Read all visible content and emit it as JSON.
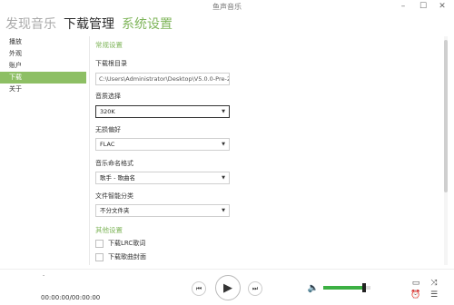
{
  "app": {
    "title": "鱼声音乐"
  },
  "window_controls": {
    "minimize": "–",
    "maximize": "☐",
    "close": "✕"
  },
  "tabs": [
    {
      "label": "发现音乐"
    },
    {
      "label": "下载管理"
    },
    {
      "label": "系统设置"
    }
  ],
  "sidebar": {
    "items": [
      {
        "label": "播放"
      },
      {
        "label": "外观"
      },
      {
        "label": "账户"
      },
      {
        "label": "下载"
      },
      {
        "label": "关于"
      }
    ]
  },
  "settings": {
    "general_title": "常规设置",
    "download_dir_label": "下载根目录",
    "download_dir_value": "C:\\Users\\Administrator\\Desktop\\V5.0.0-Pre-2",
    "quality_label": "音质选择",
    "quality_value": "320K",
    "lossless_label": "无损偏好",
    "lossless_value": "FLAC",
    "naming_label": "音乐命名格式",
    "naming_value": "歌手 - 歌曲名",
    "classify_label": "文件智能分类",
    "classify_value": "不分文件夹",
    "other_title": "其他设置",
    "lrc_label": "下载LRC歌词",
    "cover_label": "下载歌曲封面"
  },
  "player": {
    "song_placeholder": "-",
    "time": "00:00:00/00:00:00",
    "volume_fraction": 0.86
  },
  "icons": {
    "prev": "prev-icon",
    "play": "play-icon",
    "next": "next-icon",
    "volume": "volume-icon",
    "window": "mini-window-icon",
    "shuffle": "shuffle-icon",
    "timer": "timer-icon",
    "equalizer": "equalizer-icon"
  },
  "colors": {
    "accent": "#7fb55a",
    "sidebar_active": "#8dbf64",
    "volume": "#3cb043"
  }
}
